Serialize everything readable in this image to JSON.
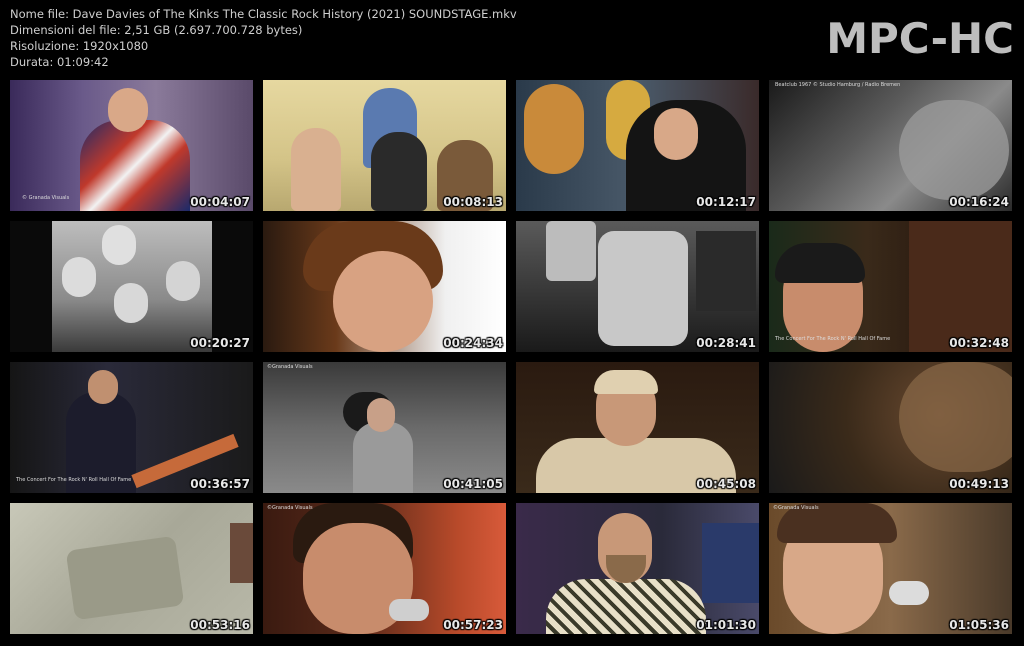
{
  "file_info": {
    "name_line": "Nome file: Dave Davies of The Kinks The Classic Rock History (2021)  SOUNDSTAGE.mkv",
    "size_line": "Dimensioni del file: 2,51 GB (2.697.700.728 bytes)",
    "resolution_line": "Risoluzione: 1920x1080",
    "duration_line": "Durata: 01:09:42"
  },
  "logo": "MPC-HC",
  "thumbnails": [
    {
      "timestamp": "00:04:07",
      "overlay": "© Granada Visuals"
    },
    {
      "timestamp": "00:08:13",
      "overlay": ""
    },
    {
      "timestamp": "00:12:17",
      "overlay": ""
    },
    {
      "timestamp": "00:16:24",
      "overlay": "Beatclub 1967 © Studio Hamburg / Radio Bremen"
    },
    {
      "timestamp": "00:20:27",
      "overlay": ""
    },
    {
      "timestamp": "00:24:34",
      "overlay": ""
    },
    {
      "timestamp": "00:28:41",
      "overlay": ""
    },
    {
      "timestamp": "00:32:48",
      "overlay": "The Concert For The Rock N' Roll Hall Of Fame"
    },
    {
      "timestamp": "00:36:57",
      "overlay": "The Concert For The Rock N' Roll Hall Of Fame"
    },
    {
      "timestamp": "00:41:05",
      "overlay": "©Granada Visuals"
    },
    {
      "timestamp": "00:45:08",
      "overlay": ""
    },
    {
      "timestamp": "00:49:13",
      "overlay": ""
    },
    {
      "timestamp": "00:53:16",
      "overlay": ""
    },
    {
      "timestamp": "00:57:23",
      "overlay": "©Granada Visuals"
    },
    {
      "timestamp": "01:01:30",
      "overlay": ""
    },
    {
      "timestamp": "01:05:36",
      "overlay": "©Granada Visuals"
    }
  ]
}
